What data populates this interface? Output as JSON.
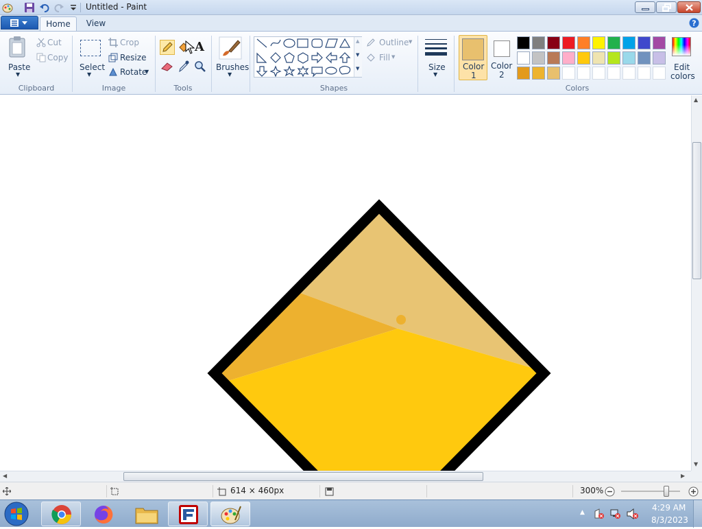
{
  "window": {
    "title": "Untitled - Paint"
  },
  "tabs": [
    {
      "label": "Home",
      "active": true
    },
    {
      "label": "View",
      "active": false
    }
  ],
  "clipboard": {
    "paste": "Paste",
    "cut": "Cut",
    "copy": "Copy",
    "group": "Clipboard"
  },
  "image": {
    "select": "Select",
    "crop": "Crop",
    "resize": "Resize",
    "rotate": "Rotate",
    "group": "Image"
  },
  "tools": {
    "group": "Tools",
    "text_tool": "A"
  },
  "brushes": {
    "label": "Brushes"
  },
  "shapes": {
    "outline": "Outline",
    "fill": "Fill",
    "group": "Shapes"
  },
  "size": {
    "label": "Size"
  },
  "colors": {
    "color1_label": "Color",
    "color1_num": "1",
    "color2_label": "Color",
    "color2_num": "2",
    "edit_label": "Edit",
    "edit_label2": "colors",
    "group": "Colors",
    "color1": "#e8c06e",
    "color2": "#ffffff",
    "palette_row1": [
      "#000000",
      "#7f7f7f",
      "#880015",
      "#ed1c24",
      "#ff7f27",
      "#fff200",
      "#22b14c",
      "#00a2e8",
      "#3f48cc",
      "#a349a4"
    ],
    "palette_row2": [
      "#ffffff",
      "#c3c3c3",
      "#b97a57",
      "#ffaec9",
      "#ffc90e",
      "#efe4b0",
      "#b5e61d",
      "#99d9ea",
      "#7092be",
      "#c8bfe7"
    ],
    "palette_row3": [
      "#e39a1c",
      "#edb32e",
      "#e8c06e",
      "#ffffff",
      "#ffffff",
      "#ffffff",
      "#ffffff",
      "#ffffff",
      "#ffffff",
      "#ffffff"
    ]
  },
  "drawing": {
    "outline_color": "#000000",
    "top_fill": "#e8c473",
    "mid_fill": "#edb12f",
    "bottom_fill": "#ffc90e"
  },
  "status": {
    "dimensions": "614 × 460px",
    "zoom": "300%",
    "zoom_level_percent": 300
  },
  "taskbar": {
    "time": "4:29 AM",
    "date": "8/3/2023",
    "apps": [
      "chrome-icon",
      "firefox-icon",
      "file-explorer-icon",
      "filezilla-icon",
      "paint-icon"
    ]
  }
}
